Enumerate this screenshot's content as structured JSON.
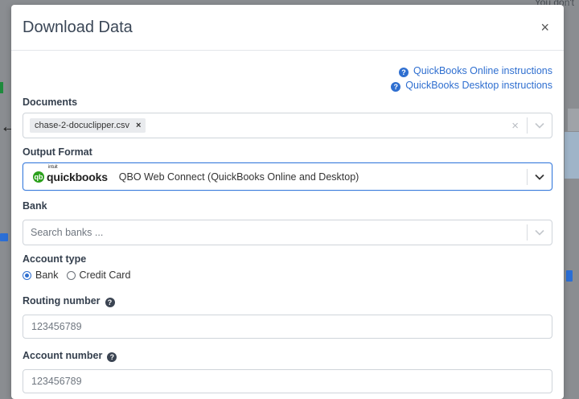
{
  "background": {
    "top_right_text": "You don't"
  },
  "modal": {
    "title": "Download Data",
    "close_label": "×",
    "links": [
      {
        "label": "QuickBooks Online instructions"
      },
      {
        "label": "QuickBooks Desktop instructions"
      }
    ],
    "documents": {
      "label": "Documents",
      "chip": "chase-2-docuclipper.csv",
      "chip_remove": "×",
      "clear": "×"
    },
    "output_format": {
      "label": "Output Format",
      "logo_brand": "quickbooks",
      "logo_small": "intuit",
      "value": "QBO Web Connect (QuickBooks Online and Desktop)"
    },
    "bank": {
      "label": "Bank",
      "placeholder": "Search banks ..."
    },
    "account_type": {
      "label": "Account type",
      "options": [
        {
          "label": "Bank",
          "checked": true
        },
        {
          "label": "Credit Card",
          "checked": false
        }
      ]
    },
    "routing_number": {
      "label": "Routing number",
      "placeholder": "123456789"
    },
    "account_number": {
      "label": "Account number",
      "placeholder": "123456789"
    }
  },
  "colors": {
    "accent": "#2f6fd0",
    "quickbooks_green": "#2ca01c",
    "overlay": "#8a8d91"
  },
  "icons": {
    "help": "question-circle-icon",
    "close": "close-icon",
    "chevron": "chevron-down-icon"
  }
}
